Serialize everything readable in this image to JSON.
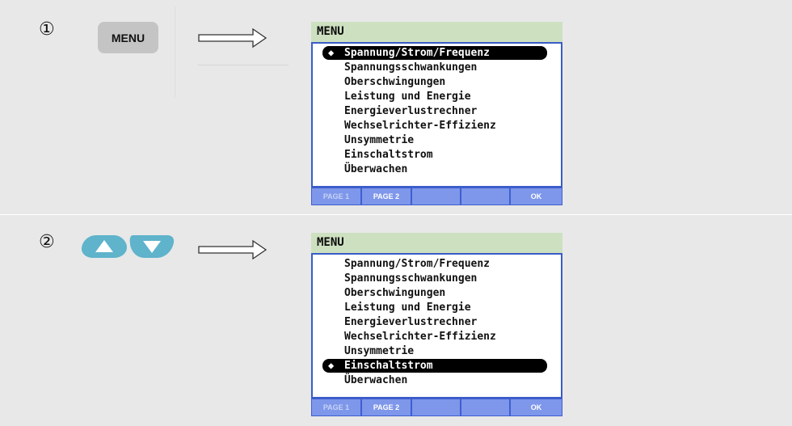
{
  "steps": [
    {
      "number": "①",
      "button_label": "MENU",
      "screen": {
        "title": "MENU",
        "items": [
          {
            "label": "Spannung/Strom/Frequenz",
            "selected": true
          },
          {
            "label": "Spannungsschwankungen",
            "selected": false
          },
          {
            "label": "Oberschwingungen",
            "selected": false
          },
          {
            "label": "Leistung und Energie",
            "selected": false
          },
          {
            "label": "Energieverlustrechner",
            "selected": false
          },
          {
            "label": "Wechselrichter-Effizienz",
            "selected": false
          },
          {
            "label": "Unsymmetrie",
            "selected": false
          },
          {
            "label": "Einschaltstrom",
            "selected": false
          },
          {
            "label": "Überwachen",
            "selected": false
          }
        ],
        "softkeys": [
          "PAGE 1",
          "PAGE 2",
          "",
          "",
          "OK"
        ]
      }
    },
    {
      "number": "②",
      "nav_keys": [
        "up-arrow-key",
        "down-arrow-key"
      ],
      "screen": {
        "title": "MENU",
        "items": [
          {
            "label": "Spannung/Strom/Frequenz",
            "selected": false
          },
          {
            "label": "Spannungsschwankungen",
            "selected": false
          },
          {
            "label": "Oberschwingungen",
            "selected": false
          },
          {
            "label": "Leistung und Energie",
            "selected": false
          },
          {
            "label": "Energieverlustrechner",
            "selected": false
          },
          {
            "label": "Wechselrichter-Effizienz",
            "selected": false
          },
          {
            "label": "Unsymmetrie",
            "selected": false
          },
          {
            "label": "Einschaltstrom",
            "selected": true
          },
          {
            "label": "Überwachen",
            "selected": false
          }
        ],
        "softkeys": [
          "PAGE 1",
          "PAGE 2",
          "",
          "",
          "OK"
        ]
      }
    }
  ],
  "colors": {
    "panel_bg": "#e8e8e8",
    "title_bar": "#cde0c0",
    "list_border": "#3a5cc9",
    "softkey_bar": "#3e5fd0",
    "softkey_button": "#7e97ea",
    "nav_key": "#5fb3cb",
    "menu_key": "#c4c4c4"
  },
  "icons": {
    "selection_marker": "up-down-arrow-icon",
    "flow": "right-arrow-icon"
  }
}
